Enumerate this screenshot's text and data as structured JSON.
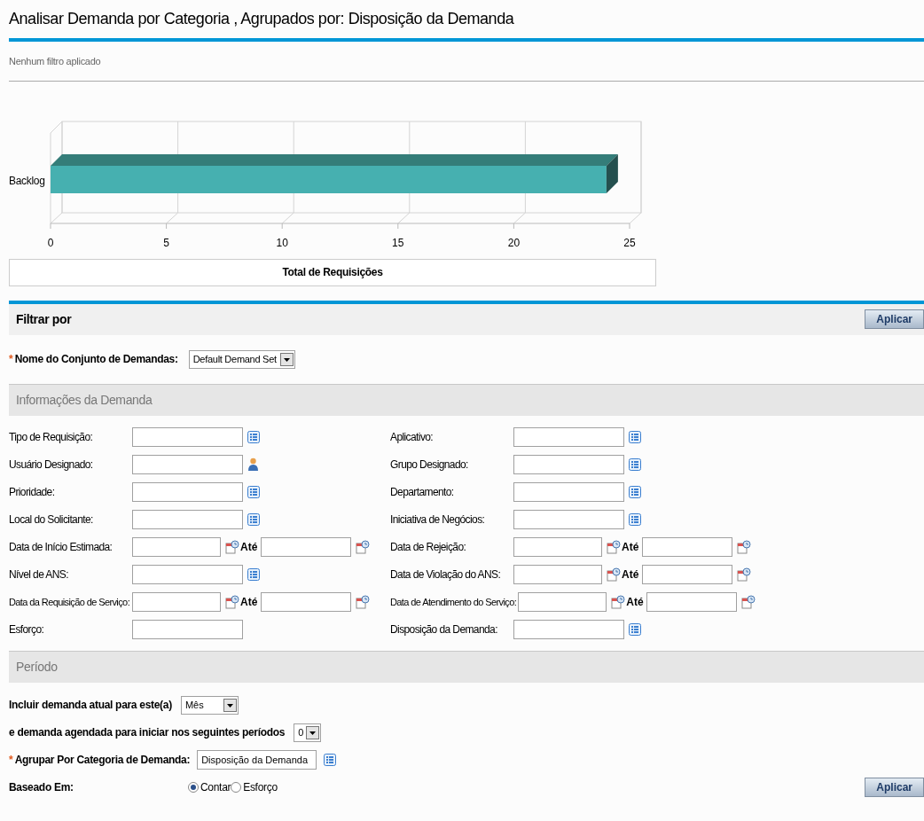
{
  "title": "Analisar Demanda por Categoria , Agrupados por: Disposição da Demanda",
  "filter_note": "Nenhum filtro aplicado",
  "chart": {
    "chart_data": {
      "type": "bar",
      "orientation": "horizontal",
      "xlabel": "Total de Requisições",
      "categories": [
        "Backlog"
      ],
      "values": [
        24
      ],
      "xlim": [
        0,
        25
      ],
      "xticks": [
        0,
        5,
        10,
        15,
        20,
        25
      ]
    }
  },
  "filter_panel": {
    "title": "Filtrar por",
    "apply_button": "Aplicar",
    "demand_set": {
      "required_mark": "*",
      "label": "Nome do Conjunto de Demandas:",
      "value": "Default Demand Set"
    }
  },
  "demand_info": {
    "title": "Informações da Demanda",
    "fields": [
      {
        "label": "Tipo de Requisição:",
        "kind": "lookup"
      },
      {
        "label": "Aplicativo:",
        "kind": "lookup"
      },
      {
        "label": "Usuário Designado:",
        "kind": "user"
      },
      {
        "label": "Grupo Designado:",
        "kind": "lookup"
      },
      {
        "label": "Prioridade:",
        "kind": "lookup"
      },
      {
        "label": "Departamento:",
        "kind": "lookup"
      },
      {
        "label": "Local do Solicitante:",
        "kind": "lookup"
      },
      {
        "label": "Iniciativa de Negócios:",
        "kind": "lookup"
      },
      {
        "label": "Data de Início Estimada:",
        "kind": "date_range",
        "to": "Até"
      },
      {
        "label": "Data de Rejeição:",
        "kind": "date_range",
        "to": "Até"
      },
      {
        "label": "Nível de ANS:",
        "kind": "lookup"
      },
      {
        "label": "Data de Violação do ANS:",
        "kind": "date_range",
        "to": "Até"
      },
      {
        "label": "Data da Requisição de Serviço:",
        "kind": "date_range",
        "to": "Até"
      },
      {
        "label": "Data de Atendimento do Serviço:",
        "kind": "date_range",
        "to": "Até"
      },
      {
        "label": "Esforço:",
        "kind": "text"
      },
      {
        "label": "Disposição da Demanda:",
        "kind": "lookup"
      }
    ]
  },
  "period": {
    "title": "Período",
    "current": {
      "label": "Incluir demanda atual para este(a)",
      "value": "Mês"
    },
    "scheduled": {
      "label": "e demanda agendada para iniciar nos seguintes períodos",
      "value": "0"
    },
    "group_by": {
      "required_mark": "*",
      "label": "Agrupar Por Categoria de Demanda:",
      "value": "Disposição da Demanda"
    },
    "based_on": {
      "label": "Baseado Em:",
      "options": [
        {
          "label": "Contar",
          "selected": true
        },
        {
          "label": "Esforço",
          "selected": false
        }
      ]
    },
    "apply_button": "Aplicar"
  }
}
